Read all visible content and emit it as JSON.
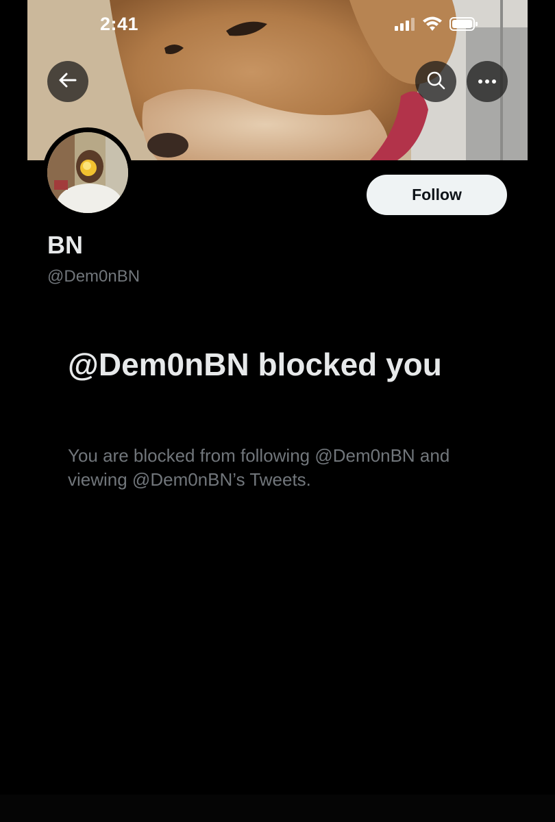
{
  "status_bar": {
    "time": "2:41",
    "signal_icon": "cellular-signal-icon",
    "wifi_icon": "wifi-icon",
    "battery_icon": "battery-icon"
  },
  "nav": {
    "back_icon": "arrow-left-icon",
    "search_icon": "search-icon",
    "more_icon": "ellipsis-icon"
  },
  "profile": {
    "display_name": "BN",
    "handle": "@Dem0nBN",
    "follow_label": "Follow"
  },
  "blocked": {
    "title": "@Dem0nBN blocked you",
    "description": "You are blocked from following @Dem0nBN and viewing @Dem0nBN’s Tweets."
  },
  "colors": {
    "background": "#000000",
    "primary_text": "#e7e9ea",
    "secondary_text": "#71767b",
    "follow_button_bg": "#eff3f4",
    "follow_button_text": "#0f1419"
  }
}
